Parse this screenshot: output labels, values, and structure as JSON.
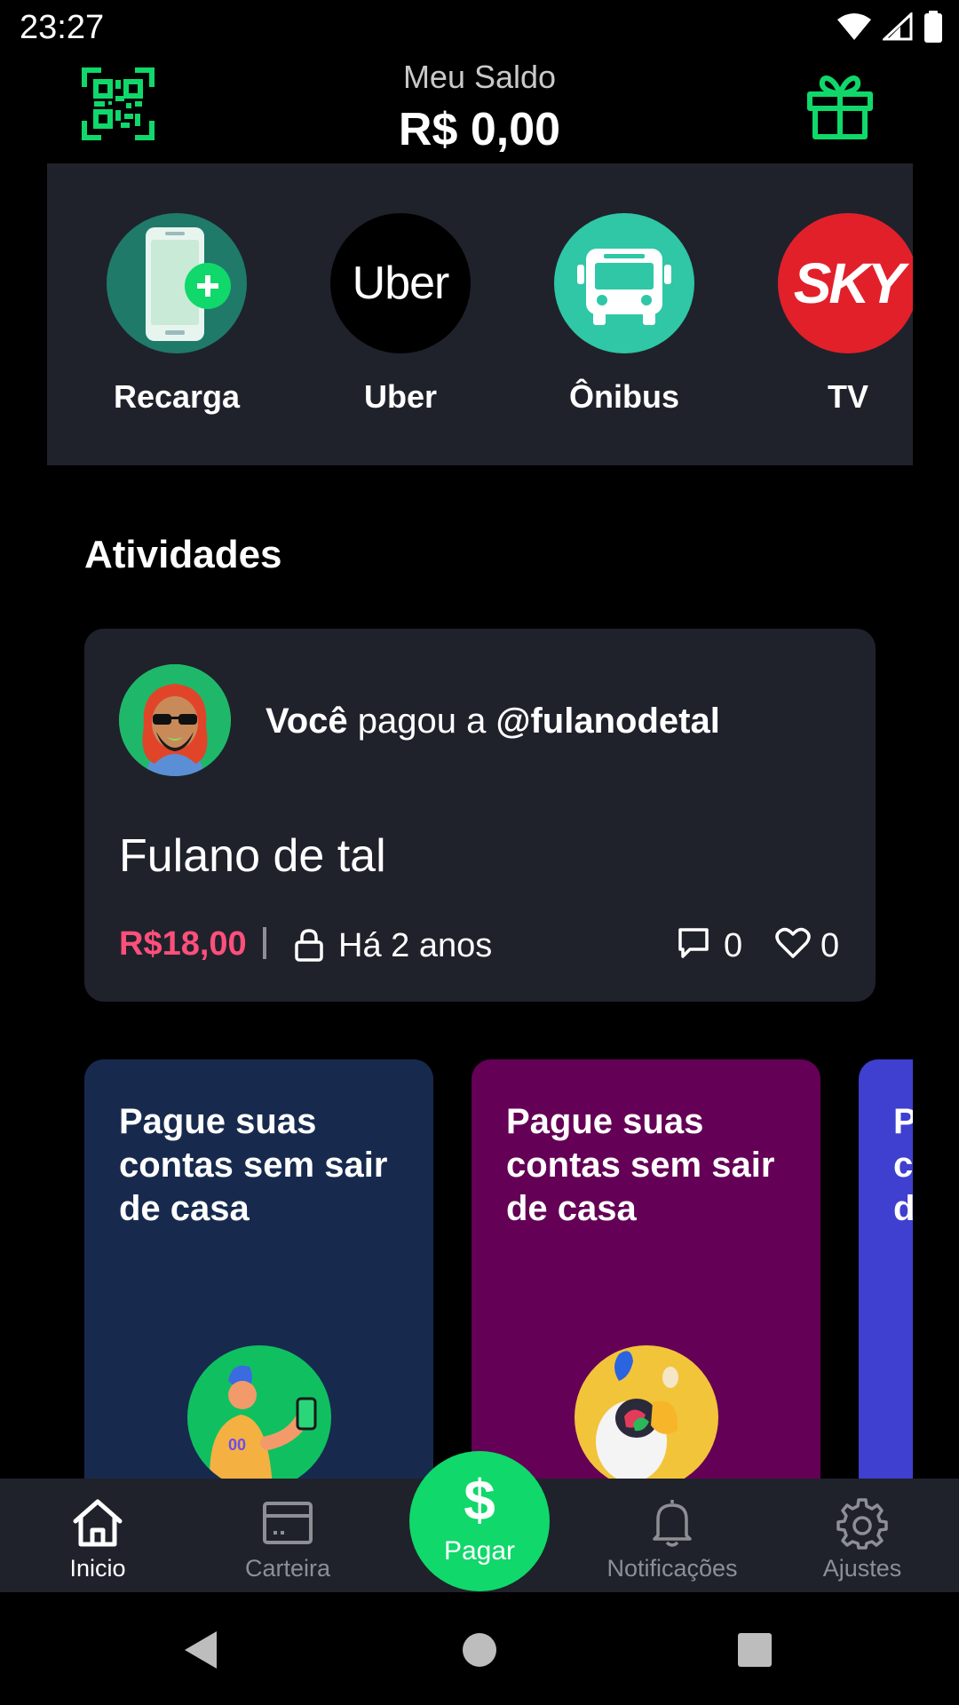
{
  "status_bar": {
    "time": "23:27",
    "icons": [
      "wifi-icon",
      "signal-icon",
      "battery-icon"
    ]
  },
  "header": {
    "balance_label": "Meu Saldo",
    "balance_value": "R$ 0,00",
    "left_icon": "qr-code-icon",
    "right_icon": "gift-icon"
  },
  "services": {
    "items": [
      {
        "label": "Recarga",
        "icon": "phone-recharge-icon"
      },
      {
        "label": "Uber",
        "icon": "uber-logo"
      },
      {
        "label": "Ônibus",
        "icon": "bus-icon"
      },
      {
        "label": "TV",
        "icon": "sky-logo"
      }
    ],
    "uber_logo_text": "Uber",
    "sky_logo_text": "SKY"
  },
  "activities": {
    "title": "Atividades",
    "item": {
      "actor": "Você",
      "verb": "pagou a",
      "target": "@fulanodetal",
      "name": "Fulano de tal",
      "amount": "R$18,00",
      "time": "Há 2 anos",
      "comments": "0",
      "likes": "0"
    }
  },
  "promos": [
    {
      "text": "Pague suas contas sem sair de casa",
      "color": "#172a4e"
    },
    {
      "text": "Pague suas contas sem sair de casa",
      "color": "#640055"
    },
    {
      "text": "Pague suas contas sem sair de casa",
      "color": "#3f3fd0"
    }
  ],
  "bottom_nav": {
    "items": [
      {
        "label": "Inicio",
        "icon": "home-icon",
        "active": true
      },
      {
        "label": "Carteira",
        "icon": "wallet-icon"
      },
      {
        "label": "Notificações",
        "icon": "bell-icon"
      },
      {
        "label": "Ajustes",
        "icon": "gear-icon"
      }
    ],
    "pay": {
      "label": "Pagar",
      "icon_text": "$"
    }
  },
  "colors": {
    "accent_green": "#10d86a",
    "amount_red": "#ff4f7b",
    "card_bg": "#1f222b",
    "background": "#000000"
  }
}
